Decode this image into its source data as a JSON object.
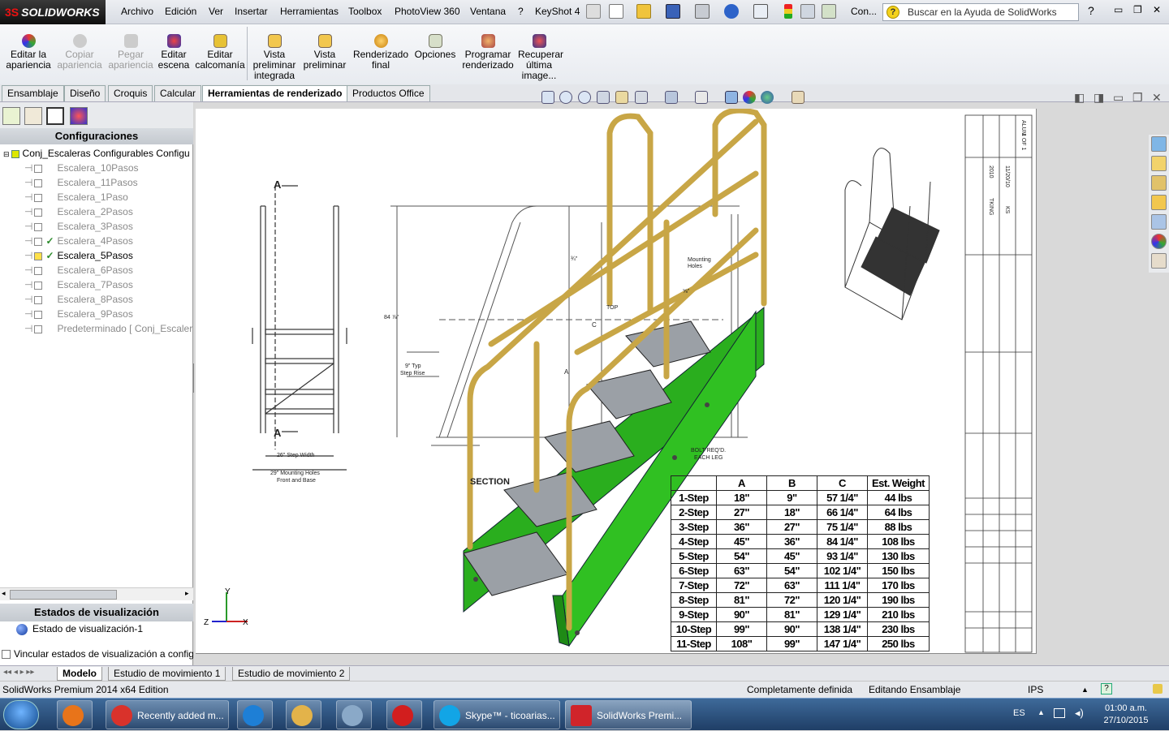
{
  "app": {
    "logo_text": "SOLIDWORKS",
    "logo_prefix": "3S"
  },
  "menubar": {
    "items": [
      "Archivo",
      "Edición",
      "Ver",
      "Insertar",
      "Herramientas",
      "Toolbox",
      "PhotoView 360",
      "Ventana",
      "?",
      "KeyShot 4"
    ],
    "config_dropdown": "Con...",
    "help_search_placeholder": "Buscar en la Ayuda de SolidWorks"
  },
  "ribbon": {
    "buttons": [
      {
        "label": "Editar la apariencia",
        "enabled": true
      },
      {
        "label": "Copiar apariencia",
        "enabled": false
      },
      {
        "label": "Pegar apariencia",
        "enabled": false
      },
      {
        "label": "Editar escena",
        "enabled": true
      },
      {
        "label": "Editar calcomanía",
        "enabled": true
      },
      {
        "label": "Vista preliminar integrada",
        "enabled": true
      },
      {
        "label": "Vista preliminar",
        "enabled": true
      },
      {
        "label": "Renderizado final",
        "enabled": true
      },
      {
        "label": "Opciones",
        "enabled": true
      },
      {
        "label": "Programar renderizado",
        "enabled": true
      },
      {
        "label": "Recuperar última image...",
        "enabled": true
      }
    ]
  },
  "tabs": [
    "Ensamblaje",
    "Diseño",
    "Croquis",
    "Calcular",
    "Herramientas de renderizado",
    "Productos Office"
  ],
  "active_tab": "Herramientas de renderizado",
  "config_panel": {
    "title": "Configuraciones",
    "root": "Conj_Escaleras Configurables Configu",
    "items": [
      {
        "label": "Escalera_10Pasos",
        "check": "",
        "active": false
      },
      {
        "label": "Escalera_11Pasos",
        "check": "",
        "active": false
      },
      {
        "label": "Escalera_1Paso",
        "check": "",
        "active": false
      },
      {
        "label": "Escalera_2Pasos",
        "check": "",
        "active": false
      },
      {
        "label": "Escalera_3Pasos",
        "check": "",
        "active": false
      },
      {
        "label": "Escalera_4Pasos",
        "check": "✓",
        "active": false
      },
      {
        "label": "Escalera_5Pasos",
        "check": "✓",
        "active": true
      },
      {
        "label": "Escalera_6Pasos",
        "check": "",
        "active": false
      },
      {
        "label": "Escalera_7Pasos",
        "check": "",
        "active": false
      },
      {
        "label": "Escalera_8Pasos",
        "check": "",
        "active": false
      },
      {
        "label": "Escalera_9Pasos",
        "check": "",
        "active": false
      },
      {
        "label": "Predeterminado [ Conj_Escaler",
        "check": "",
        "active": false
      }
    ],
    "display_states_title": "Estados de visualización",
    "display_state": "Estado de visualización-1",
    "link_label": "Vincular estados de visualización a configu"
  },
  "drawing": {
    "labels": {
      "section_a_top": "A",
      "section_a_bottom": "A",
      "step_width": "26\" Step Width",
      "mounting_holes_1": "29\" Mounting Holes",
      "mounting_holes_2": "Front and Base",
      "height": "84 ⅞\"",
      "step_rise_1": "9\" Typ",
      "step_rise_2": "Step Rise",
      "mounting_label_1": "Mounting",
      "mounting_label_2": "Holes",
      "bolt_1": "BOLT REQ'D.",
      "bolt_2": "EACH LEG",
      "dim_a": "A",
      "dim_c": "C",
      "section_text": "SECTION",
      "top_label": "TOP",
      "frac": "⅝\"",
      "top_frac": "¾\""
    },
    "table_headers": [
      "",
      "A",
      "B",
      "C",
      "Est. Weight"
    ],
    "table_rows": [
      [
        "1-Step",
        "18\"",
        "9\"",
        "57 1/4\"",
        "44 lbs"
      ],
      [
        "2-Step",
        "27\"",
        "18\"",
        "66 1/4\"",
        "64 lbs"
      ],
      [
        "3-Step",
        "36\"",
        "27\"",
        "75 1/4\"",
        "88 lbs"
      ],
      [
        "4-Step",
        "45\"",
        "36\"",
        "84 1/4\"",
        "108 lbs"
      ],
      [
        "5-Step",
        "54\"",
        "45\"",
        "93 1/4\"",
        "130 lbs"
      ],
      [
        "6-Step",
        "63\"",
        "54\"",
        "102 1/4\"",
        "150 lbs"
      ],
      [
        "7-Step",
        "72\"",
        "63\"",
        "111 1/4\"",
        "170 lbs"
      ],
      [
        "8-Step",
        "81\"",
        "72\"",
        "120 1/4\"",
        "190 lbs"
      ],
      [
        "9-Step",
        "90\"",
        "81\"",
        "129 1/4\"",
        "210 lbs"
      ],
      [
        "10-Step",
        "99\"",
        "90\"",
        "138 1/4\"",
        "230 lbs"
      ],
      [
        "11-Step",
        "108\"",
        "99\"",
        "147 1/4\"",
        "250 lbs"
      ]
    ],
    "title_block": [
      "ALUM",
      "1 OF 1",
      "2010",
      "11/20/10",
      "TKING",
      "KS"
    ]
  },
  "axes": {
    "x": "X",
    "y": "Y",
    "z": "Z"
  },
  "bottom_tabs": [
    "Modelo",
    "Estudio de movimiento 1",
    "Estudio de movimiento 2"
  ],
  "active_bottom_tab": "Modelo",
  "status": {
    "edition": "SolidWorks Premium 2014 x64 Edition",
    "definition": "Completamente definida",
    "mode": "Editando Ensamblaje",
    "units": "IPS"
  },
  "taskbar": {
    "buttons": [
      {
        "label": "",
        "color": "#e8741a"
      },
      {
        "label": "Recently added m...",
        "color": "#d9322b"
      },
      {
        "label": "",
        "color": "#1e7fd6"
      },
      {
        "label": "",
        "color": "#e3b34a"
      },
      {
        "label": "",
        "color": "#8aa9c8"
      },
      {
        "label": "",
        "color": "#d21e1e"
      },
      {
        "label": "Skype™ - ticoarias...",
        "color": "#12a5e6"
      },
      {
        "label": "SolidWorks Premi...",
        "color": "#d0242a"
      }
    ],
    "lang": "ES",
    "time": "01:00 a.m.",
    "date": "27/10/2015"
  },
  "colors": {
    "green_part": "#27b01c",
    "rail_part": "#c8a646",
    "tread": "#9ba0a6"
  }
}
